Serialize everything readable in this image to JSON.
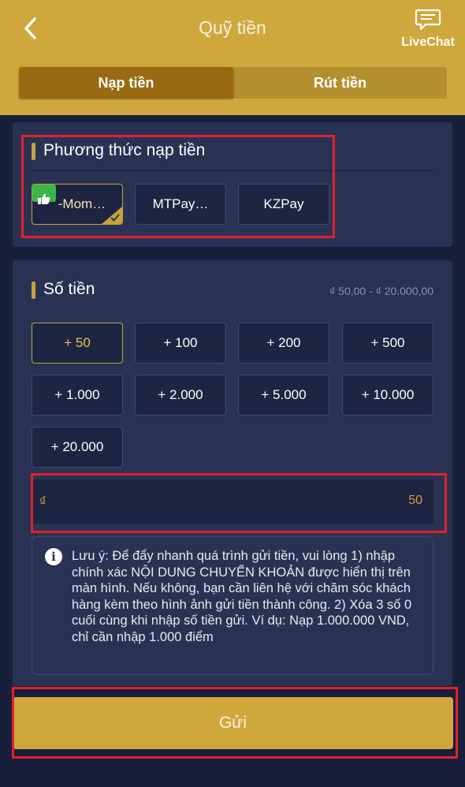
{
  "header": {
    "title": "Quỹ tiền",
    "back_icon": "chevron-left-icon",
    "livechat": {
      "icon": "chat-bubble-icon",
      "label": "LiveChat"
    }
  },
  "tabs": [
    {
      "label": "Nạp tiền",
      "active": true
    },
    {
      "label": "Rút tiền",
      "active": false
    }
  ],
  "method_section": {
    "title": "Phương thức nạp tiền",
    "methods": [
      {
        "label": "-Mom…",
        "selected": true,
        "badge": "thumbs-up-icon"
      },
      {
        "label": "MTPay…",
        "selected": false
      },
      {
        "label": "KZPay",
        "selected": false
      }
    ]
  },
  "amount_section": {
    "title": "Số tiền",
    "range": "₫ 50,00 - ₫ 20.000,00",
    "presets": [
      "+ 50",
      "+ 100",
      "+ 200",
      "+ 500",
      "+ 1.000",
      "+ 2.000",
      "+ 5.000",
      "+ 10.000",
      "+ 20.000"
    ],
    "selected_preset": "+ 50",
    "input": {
      "currency": "₫",
      "value": "50"
    }
  },
  "note": {
    "icon": "info-icon",
    "text": "Lưu ý: Để đẩy nhanh quá trình gửi tiền, vui lòng 1) nhập chính xác NỘI DUNG CHUYỂN KHOẢN được hiển thị trên màn hình. Nếu không, bạn cần liên hệ với chăm sóc khách hàng kèm theo hình ảnh gửi tiền thành công. 2) Xóa 3 số 0 cuối cùng khi nhập số tiền gửi. Ví dụ: Nạp 1.000.000 VND, chỉ cần nhập 1.000 điểm"
  },
  "submit_label": "Gửi",
  "colors": {
    "gold": "#cfa83d",
    "dark_bg": "#181f3a",
    "panel": "#2a3254",
    "highlight_red": "#e0212b",
    "badge_green": "#3ab54a"
  }
}
